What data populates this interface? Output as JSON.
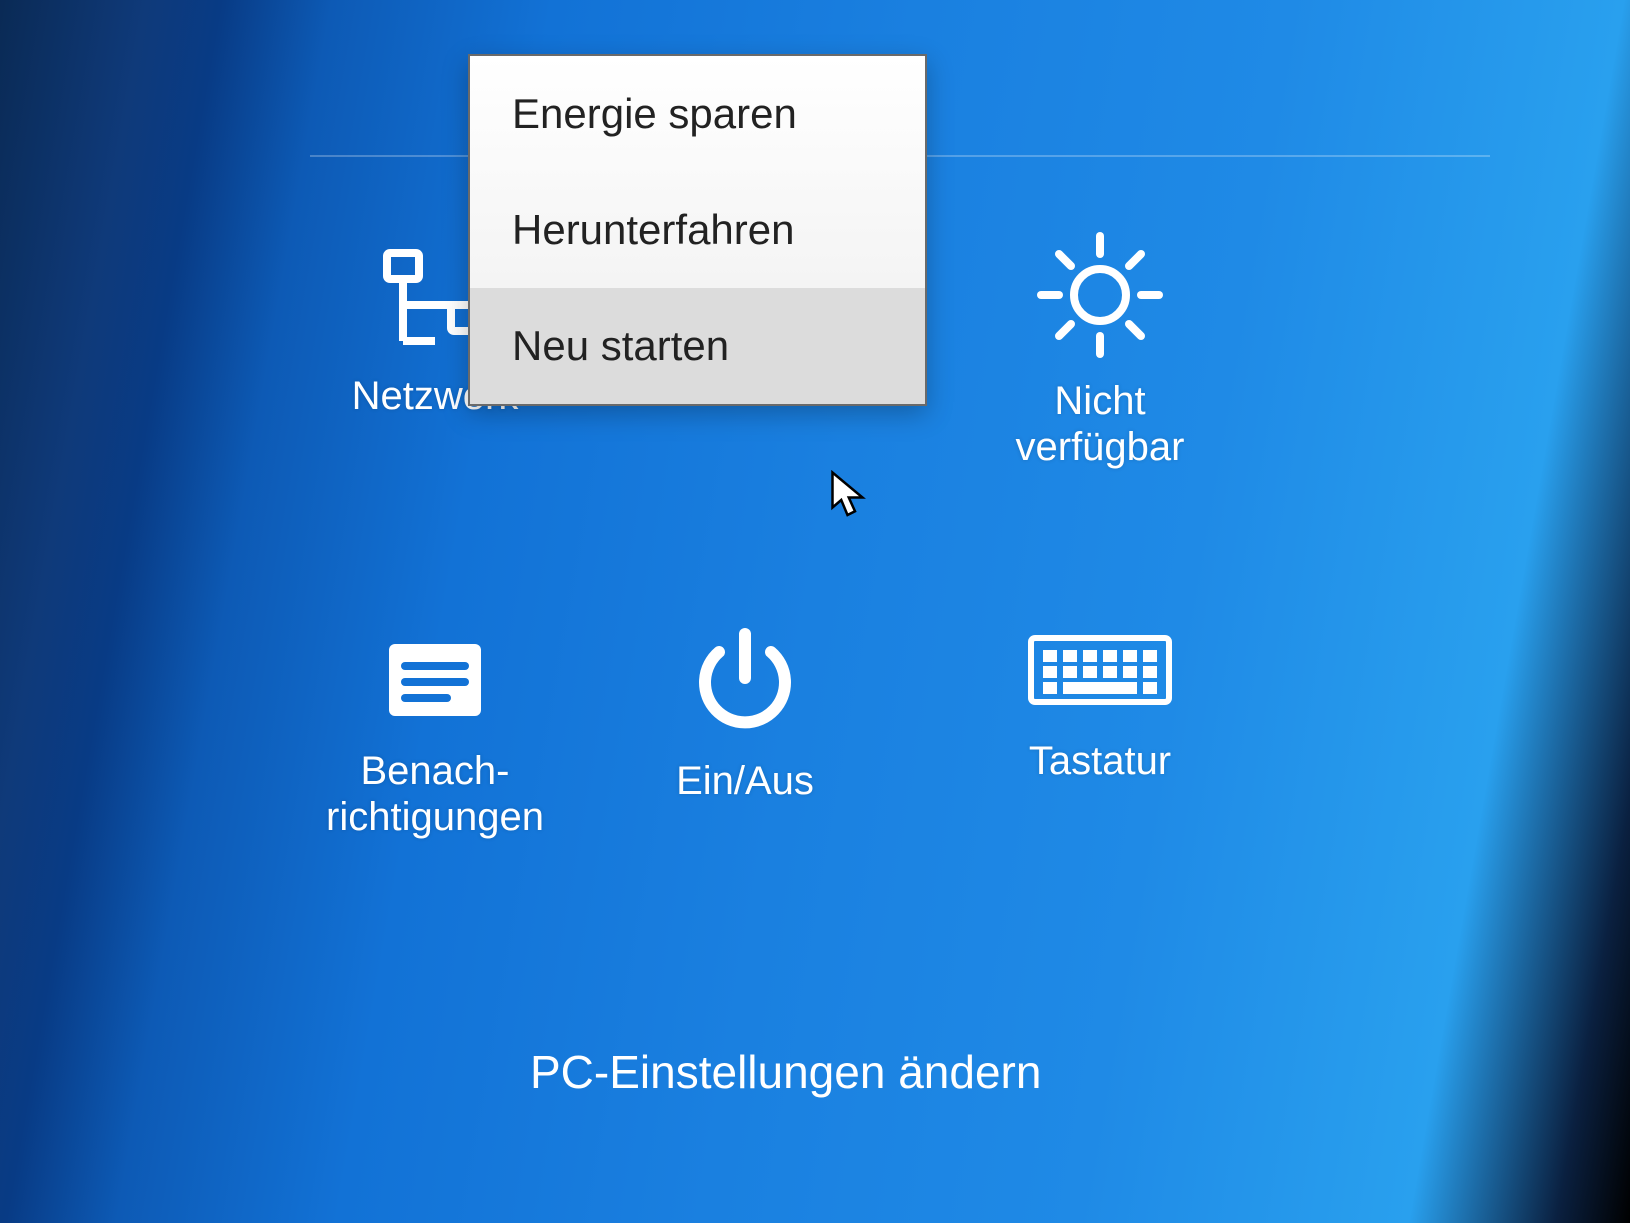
{
  "charms": {
    "network": {
      "label": "Netzwerk"
    },
    "brightness": {
      "label": "Nicht\nverfügbar"
    },
    "notifications": {
      "label": "Benach-\nrichtigungen"
    },
    "power": {
      "label": "Ein/Aus"
    },
    "keyboard": {
      "label": "Tastatur"
    }
  },
  "power_menu": {
    "items": [
      {
        "label": "Energie sparen"
      },
      {
        "label": "Herunterfahren"
      },
      {
        "label": "Neu starten"
      }
    ],
    "hovered_index": 2
  },
  "footer": {
    "change_settings": "PC-Einstellungen ändern"
  }
}
